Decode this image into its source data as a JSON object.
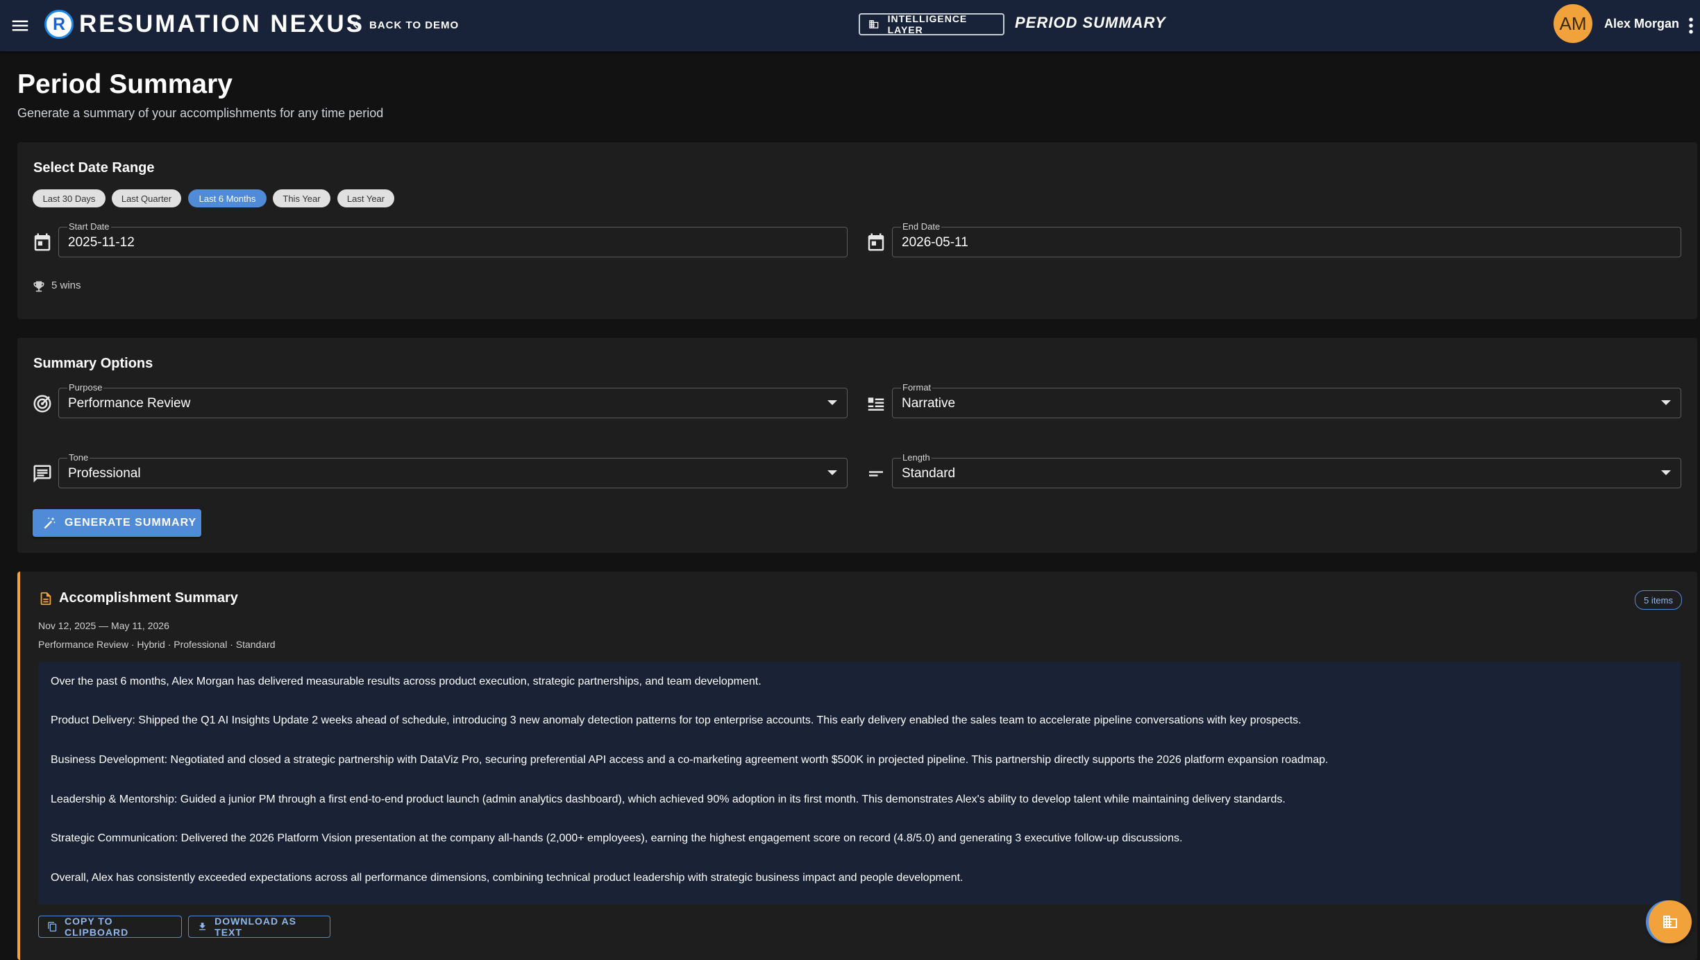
{
  "header": {
    "brand_letter": "R",
    "brand_name": "RESUMATION NEXUS",
    "back_label": "BACK TO DEMO",
    "layer_label": "INTELLIGENCE LAYER",
    "page_label": "PERIOD SUMMARY",
    "avatar_initials": "AM",
    "user_name": "Alex Morgan"
  },
  "page": {
    "title": "Period Summary",
    "subtitle": "Generate a summary of your accomplishments for any time period"
  },
  "date_range": {
    "title": "Select Date Range",
    "presets": [
      "Last 30 Days",
      "Last Quarter",
      "Last 6 Months",
      "This Year",
      "Last Year"
    ],
    "active_preset": "Last 6 Months",
    "start_label": "Start Date",
    "start_value": "2025-11-12",
    "end_label": "End Date",
    "end_value": "2026-05-11",
    "wins_text": "5 wins"
  },
  "options": {
    "title": "Summary Options",
    "purpose_label": "Purpose",
    "purpose_value": "Performance Review",
    "format_label": "Format",
    "format_value": "Narrative",
    "tone_label": "Tone",
    "tone_value": "Professional",
    "length_label": "Length",
    "length_value": "Standard",
    "generate_label": "GENERATE SUMMARY"
  },
  "summary": {
    "title": "Accomplishment Summary",
    "count_badge": "5 items",
    "date_line": "Nov 12, 2025 — May 11, 2026",
    "meta_line": "Performance Review · Hybrid · Professional · Standard",
    "paragraphs": [
      "Over the past 6 months, Alex Morgan has delivered measurable results across product execution, strategic partnerships, and team development.",
      "Product Delivery: Shipped the Q1 AI Insights Update 2 weeks ahead of schedule, introducing 3 new anomaly detection patterns for top enterprise accounts. This early delivery enabled the sales team to accelerate pipeline conversations with key prospects.",
      "Business Development: Negotiated and closed a strategic partnership with DataViz Pro, securing preferential API access and a co-marketing agreement worth $500K in projected pipeline. This partnership directly supports the 2026 platform expansion roadmap.",
      "Leadership & Mentorship: Guided a junior PM through a first end-to-end product launch (admin analytics dashboard), which achieved 90% adoption in its first month. This demonstrates Alex's ability to develop talent while maintaining delivery standards.",
      "Strategic Communication: Delivered the 2026 Platform Vision presentation at the company all-hands (2,000+ employees), earning the highest engagement score on record (4.8/5.0) and generating 3 executive follow-up discussions.",
      "Overall, Alex has consistently exceeded expectations across all performance dimensions, combining technical product leadership with strategic business impact and people development."
    ],
    "copy_label": "COPY TO CLIPBOARD",
    "download_label": "DOWNLOAD AS TEXT"
  },
  "colors": {
    "appbar": "#18233a",
    "accent_blue": "#4f8bd6",
    "accent_orange": "#f2a23a",
    "card": "#1e1e1e",
    "background": "#121212"
  },
  "icons": [
    "menu-icon",
    "arrow-left-icon",
    "business-icon",
    "more-vert-icon",
    "calendar-icon",
    "trophy-icon",
    "target-icon",
    "format-list-icon",
    "chat-icon",
    "short-text-icon",
    "magic-wand-icon",
    "document-icon",
    "copy-icon",
    "download-icon"
  ]
}
